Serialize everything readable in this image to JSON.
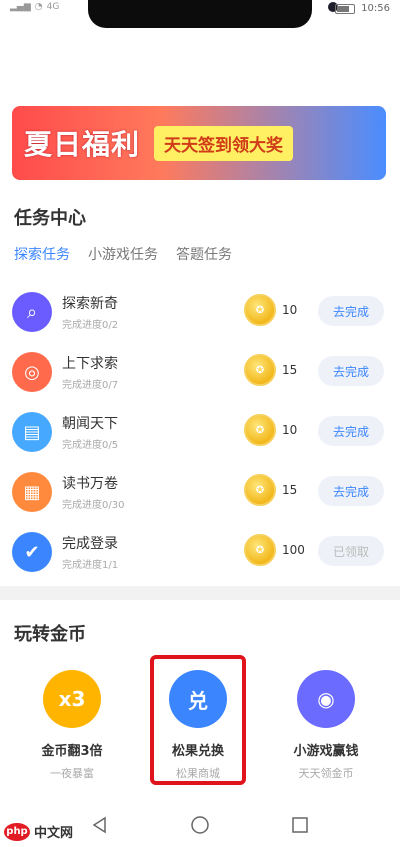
{
  "status_bar": {
    "time": "10:56",
    "network": "4G"
  },
  "banner": {
    "title": "夏日福利",
    "subtitle": "天天签到领大奖"
  },
  "tasks_section": {
    "title": "任务中心",
    "tabs": [
      "探索任务",
      "小游戏任务",
      "答题任务"
    ],
    "active_tab": "探索任务",
    "items": [
      {
        "name": "探索新奇",
        "progress": "完成进度0/2",
        "coin": "10",
        "button": "去完成",
        "icon": "search-icon",
        "color": "#6a5cff"
      },
      {
        "name": "上下求索",
        "progress": "完成进度0/7",
        "coin": "15",
        "button": "去完成",
        "icon": "chrome-like-icon",
        "color": "#ff6a4d"
      },
      {
        "name": "朝闻天下",
        "progress": "完成进度0/5",
        "coin": "10",
        "button": "去完成",
        "icon": "news-icon",
        "color": "#46a9ff"
      },
      {
        "name": "读书万卷",
        "progress": "完成进度0/30",
        "coin": "15",
        "button": "去完成",
        "icon": "book-icon",
        "color": "#ff8a3d"
      },
      {
        "name": "完成登录",
        "progress": "完成进度1/1",
        "coin": "100",
        "button": "已领取",
        "icon": "check-icon",
        "color": "#3b86ff"
      }
    ]
  },
  "games_section": {
    "title": "玩转金币",
    "items": [
      {
        "name": "金币翻3倍",
        "sub": "一夜暴富",
        "badge": "x3",
        "color": "#ffb400",
        "icon": "coin-triple-icon"
      },
      {
        "name": "松果兑换",
        "sub": "松果商城",
        "badge": "兑",
        "color": "#3b86ff",
        "icon": "exchange-icon"
      },
      {
        "name": "小游戏赢钱",
        "sub": "天天领金币",
        "badge": "◉",
        "color": "#6b6bff",
        "icon": "gamepad-icon"
      }
    ]
  },
  "watermark": {
    "logo": "php",
    "text": "中文网"
  }
}
